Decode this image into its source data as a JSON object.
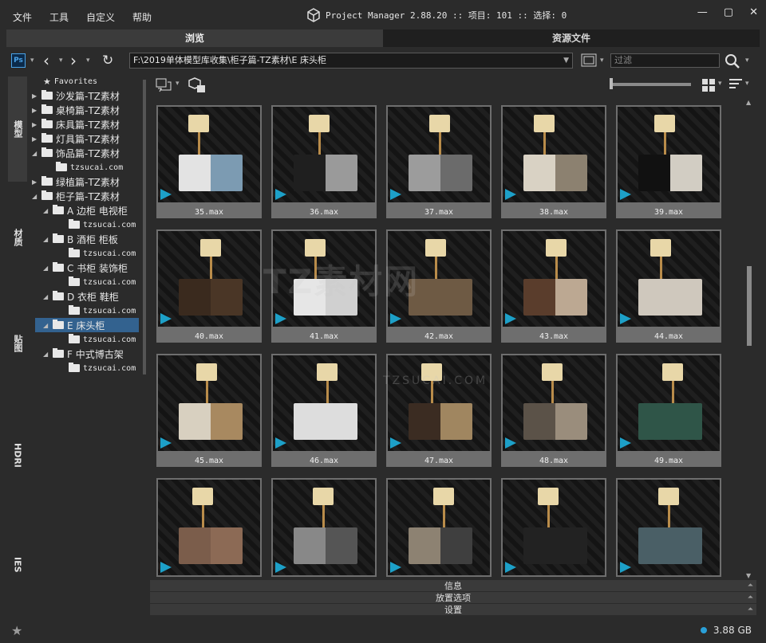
{
  "menu": [
    "文件",
    "工具",
    "自定义",
    "帮助"
  ],
  "title": "Project Manager 2.88.20  :: 项目: 101  :: 选择: 0",
  "window_controls": [
    "minimize-icon",
    "maximize-icon",
    "close-icon"
  ],
  "tabs": [
    {
      "label": "浏览",
      "active": true
    },
    {
      "label": "资源文件",
      "active": false
    }
  ],
  "pathbar": {
    "path": "F:\\2019单体模型库收集\\柜子篇-TZ素材\\E 床头柜",
    "filter_placeholder": "过滤"
  },
  "side_tabs": [
    "模型",
    "材质",
    "贴图",
    "HDRI",
    "IES"
  ],
  "tree": [
    {
      "label": "Favorites",
      "level": 0,
      "icon": "star-folder-icon"
    },
    {
      "label": "沙发篇-TZ素材",
      "level": 0
    },
    {
      "label": "桌椅篇-TZ素材",
      "level": 0
    },
    {
      "label": "床具篇-TZ素材",
      "level": 0
    },
    {
      "label": "灯具篇-TZ素材",
      "level": 0
    },
    {
      "label": "饰品篇-TZ素材",
      "level": 0
    },
    {
      "label": "tzsucai.com",
      "level": 1
    },
    {
      "label": "绿植篇-TZ素材",
      "level": 0
    },
    {
      "label": "柜子篇-TZ素材",
      "level": 0
    },
    {
      "label": "A 边柜 电视柜",
      "level": 1
    },
    {
      "label": "tzsucai.com",
      "level": 2
    },
    {
      "label": "B 酒柜 柜板",
      "level": 1
    },
    {
      "label": "tzsucai.com",
      "level": 2
    },
    {
      "label": "C 书柜 装饰柜",
      "level": 1
    },
    {
      "label": "tzsucai.com",
      "level": 2
    },
    {
      "label": "D 衣柜 鞋柜",
      "level": 1
    },
    {
      "label": "tzsucai.com",
      "level": 2
    },
    {
      "label": "E 床头柜",
      "level": 1,
      "selected": true
    },
    {
      "label": "tzsucai.com",
      "level": 2
    },
    {
      "label": "F 中式博古架",
      "level": 1
    },
    {
      "label": "tzsucai.com",
      "level": 2
    }
  ],
  "files": [
    "35.max",
    "36.max",
    "37.max",
    "38.max",
    "39.max",
    "40.max",
    "41.max",
    "42.max",
    "43.max",
    "44.max",
    "45.max",
    "46.max",
    "47.max",
    "48.max",
    "49.max",
    "",
    "",
    "",
    "",
    ""
  ],
  "panels": [
    "信息",
    "放置选项",
    "设置"
  ],
  "status": {
    "memory": "3.88 GB"
  },
  "watermark": {
    "main": "TZ素材网",
    "sub": "TZSUCAI.COM"
  },
  "colors": {
    "accent": "#2aa0d8",
    "selection": "#33628f",
    "max_icon": "#1da0c8"
  }
}
